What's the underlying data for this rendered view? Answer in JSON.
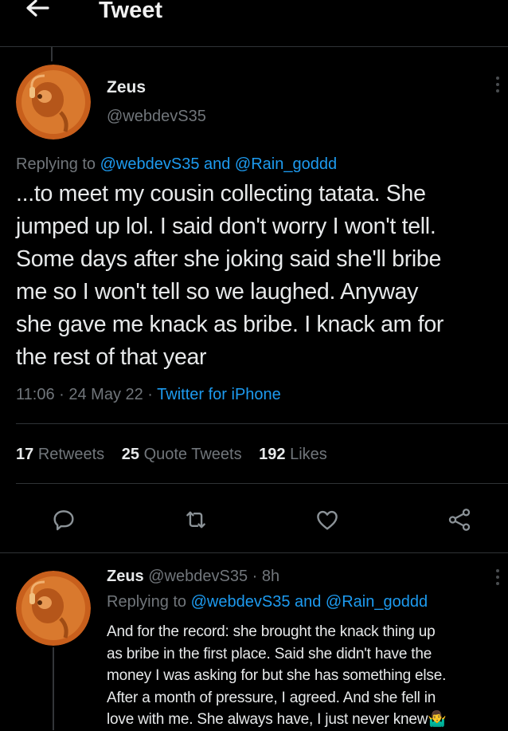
{
  "header": {
    "title": "Tweet",
    "back_icon": "arrow-left-icon"
  },
  "main_tweet": {
    "author_name": "Zeus",
    "author_handle": "@webdevS35",
    "replying_prefix": "Replying to ",
    "replying_users": "@webdevS35 and @Rain_goddd",
    "text_lines": [
      "...to meet my cousin collecting tatata. She",
      "jumped up lol. I said don't worry I won't tell.",
      "Some days after she joking said she'll bribe",
      "me so I won't tell so we laughed. Anyway",
      "she gave me knack as bribe. I knack am for",
      "the rest of that year"
    ],
    "time": "11:06",
    "sep1": " · ",
    "date": "24 May 22",
    "sep2": " · ",
    "source": "Twitter for iPhone"
  },
  "stats": {
    "retweets_count": "17",
    "retweets_label": "Retweets",
    "quotes_count": "25",
    "quotes_label": "Quote Tweets",
    "likes_count": "192",
    "likes_label": "Likes"
  },
  "actions": {
    "reply_icon": "reply-icon",
    "retweet_icon": "retweet-icon",
    "like_icon": "heart-icon",
    "share_icon": "share-icon"
  },
  "reply_tweet": {
    "author_name": "Zeus",
    "author_handle": "@webdevS35",
    "time_ago": " · 8h",
    "replying_prefix": "Replying to ",
    "replying_users": "@webdevS35 and @Rain_goddd",
    "text_lines": [
      "And for the record: she brought the knack thing up",
      "as bribe in the first place. Said she didn't have the",
      "money I was asking for but she has something else.",
      "After a month of pressure, I agreed. And she fell in",
      "love with me. She always have, I just never knew"
    ],
    "emoji": "🤷‍♂️"
  },
  "colors": {
    "accent": "#1d9bf0",
    "background": "#000000",
    "muted": "#71767b",
    "avatar": "#d46a1e"
  }
}
